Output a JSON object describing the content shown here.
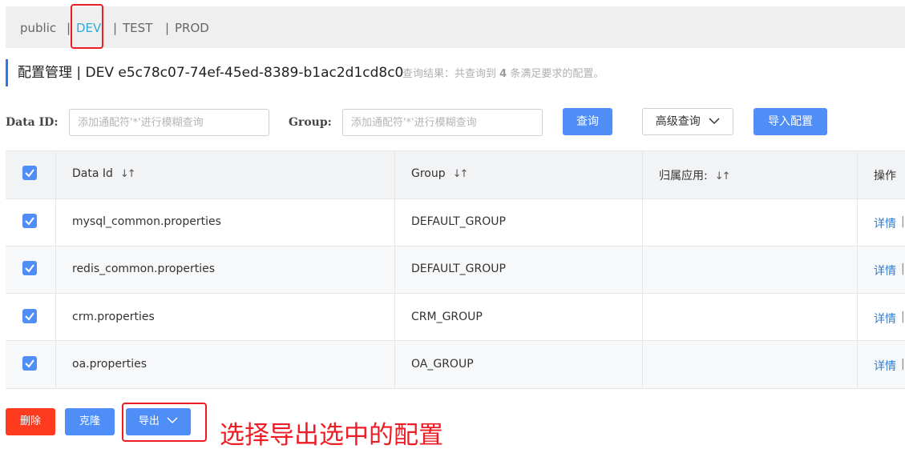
{
  "namespaces": {
    "items": [
      "public",
      "DEV",
      "TEST",
      "PROD"
    ],
    "separator": "|",
    "active": "DEV"
  },
  "header": {
    "title": "配置管理 | DEV  e5c78c07-74ef-45ed-8389-b1ac2d1cd8c0",
    "result_prefix": "查询结果：共查询到",
    "result_count": "4",
    "result_suffix": "条满足要求的配置。"
  },
  "search": {
    "data_id_label": "Data ID:",
    "data_id_placeholder": "添加通配符'*'进行模糊查询",
    "group_label": "Group:",
    "group_placeholder": "添加通配符'*'进行模糊查询",
    "query_button": "查询",
    "advanced_button": "高级查询",
    "import_button": "导入配置"
  },
  "table": {
    "headers": {
      "data_id": "Data Id",
      "group": "Group",
      "app": "归属应用:",
      "actions": "操作"
    },
    "sort_glyph": "↓↑",
    "rows": [
      {
        "data_id": "mysql_common.properties",
        "group": "DEFAULT_GROUP",
        "app": "",
        "action": "详情"
      },
      {
        "data_id": "redis_common.properties",
        "group": "DEFAULT_GROUP",
        "app": "",
        "action": "详情"
      },
      {
        "data_id": "crm.properties",
        "group": "CRM_GROUP",
        "app": "",
        "action": "详情"
      },
      {
        "data_id": "oa.properties",
        "group": "OA_GROUP",
        "app": "",
        "action": "详情"
      }
    ],
    "action_separator": "|"
  },
  "bottom": {
    "delete_button": "删除",
    "clone_button": "克隆",
    "export_button": "导出"
  },
  "annotation": {
    "text": "选择导出选中的配置"
  },
  "colors": {
    "primary": "#4f8ef7",
    "danger": "#ff3b1f",
    "active_tab": "#33a9d8",
    "annotation": "#ee1c25",
    "link": "#2f7dd1"
  }
}
